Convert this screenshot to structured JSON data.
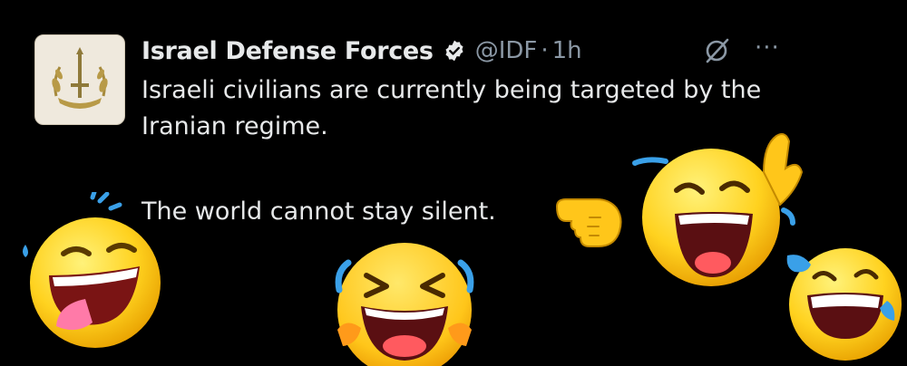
{
  "post": {
    "author_name": "Israel Defense Forces",
    "handle": "@IDF",
    "separator": "·",
    "time": "1h",
    "text_line1": "Israeli civilians are currently being targeted by the Iranian regime.",
    "text_line2": "The world cannot stay silent."
  },
  "icons": {
    "avatar": "idf-emblem",
    "verified": "verified-badge-icon",
    "grok": "grok-icon",
    "more": "more-icon"
  },
  "more_glyph": "···",
  "stickers": [
    "laughing-tongue-emoji",
    "crying-laughing-emoji",
    "pointing-hand-emoji",
    "laughing-hand-up-emoji",
    "tears-of-joy-emoji"
  ],
  "colors": {
    "background": "#000000",
    "primary_text": "#e7e9ea",
    "secondary_text": "#8b98a5",
    "emoji_yellow": "#ffd21f",
    "tears": "#3aa0e8"
  }
}
